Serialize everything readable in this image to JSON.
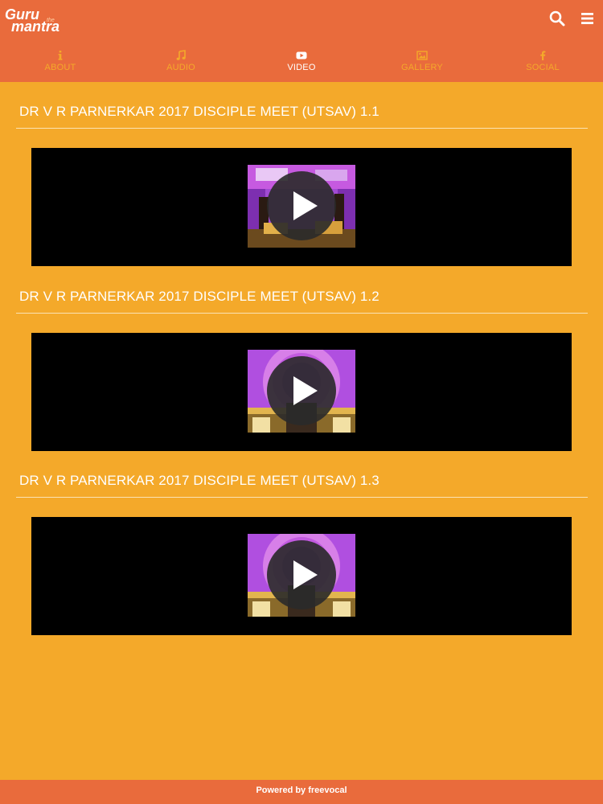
{
  "header": {
    "logo_line1": "Guru",
    "logo_line2": "mantra",
    "logo_tag": "the",
    "search_icon": "search-icon",
    "menu_icon": "hamburger-menu-icon"
  },
  "nav": {
    "items": [
      {
        "label": "ABOUT",
        "icon": "info-icon",
        "active": false
      },
      {
        "label": "AUDIO",
        "icon": "music-note-icon",
        "active": false
      },
      {
        "label": "VIDEO",
        "icon": "youtube-play-icon",
        "active": true
      },
      {
        "label": "GALLERY",
        "icon": "image-icon",
        "active": false
      },
      {
        "label": "SOCIAL",
        "icon": "facebook-icon",
        "active": false
      }
    ]
  },
  "videos": [
    {
      "title": "DR V R PARNERKAR 2017 DISCIPLE MEET (UTSAV) 1.1"
    },
    {
      "title": "DR V R PARNERKAR 2017 DISCIPLE MEET (UTSAV) 1.2"
    },
    {
      "title": "DR V R PARNERKAR 2017 DISCIPLE MEET (UTSAV) 1.3"
    }
  ],
  "footer": {
    "text": "Powered by freevocal"
  },
  "colors": {
    "header": "#e96b3c",
    "background": "#f4a92a",
    "nav_inactive": "#f4a92a",
    "nav_active": "#ffffff",
    "player": "#000000"
  }
}
